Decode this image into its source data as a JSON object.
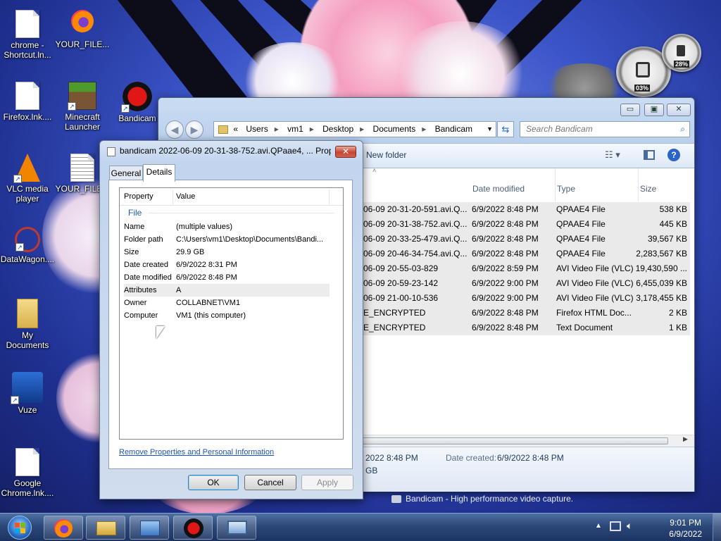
{
  "desktop": {
    "icons": [
      {
        "label": "chrome - Shortcut.ln..."
      },
      {
        "label": "YOUR_FILE..."
      },
      {
        "label": "Firefox.lnk...."
      },
      {
        "label": "Minecraft Launcher"
      },
      {
        "label": "Bandicam"
      },
      {
        "label": "VLC media player"
      },
      {
        "label": "YOUR_FILE..."
      },
      {
        "label": "DataWagon...."
      },
      {
        "label": "My Documents"
      },
      {
        "label": "Vuze"
      },
      {
        "label": "Google Chrome.lnk...."
      }
    ],
    "gadget": {
      "cpu_value": "03%",
      "mem_value": "28%"
    }
  },
  "explorer": {
    "caption_buttons": {
      "minimize": "▭",
      "maximize": "▣",
      "close": "✕"
    },
    "breadcrumb": [
      "«",
      "Users",
      "vm1",
      "Desktop",
      "Documents",
      "Bandicam"
    ],
    "search_placeholder": "Search Bandicam",
    "toolbar": {
      "new_folder": "New folder"
    },
    "columns": {
      "date": "Date modified",
      "type": "Type",
      "size": "Size"
    },
    "rows": [
      {
        "name": "06-09 20-31-20-591.avi.Q...",
        "date": "6/9/2022 8:48 PM",
        "type": "QPAAE4 File",
        "size": "538 KB"
      },
      {
        "name": "06-09 20-31-38-752.avi.Q...",
        "date": "6/9/2022 8:48 PM",
        "type": "QPAAE4 File",
        "size": "445 KB"
      },
      {
        "name": "06-09 20-33-25-479.avi.Q...",
        "date": "6/9/2022 8:48 PM",
        "type": "QPAAE4 File",
        "size": "39,567 KB"
      },
      {
        "name": "06-09 20-46-34-754.avi.Q...",
        "date": "6/9/2022 8:48 PM",
        "type": "QPAAE4 File",
        "size": "2,283,567 KB"
      },
      {
        "name": "06-09 20-55-03-829",
        "date": "6/9/2022 8:59 PM",
        "type": "AVI Video File (VLC)",
        "size": "19,430,590 ..."
      },
      {
        "name": "06-09 20-59-23-142",
        "date": "6/9/2022 9:00 PM",
        "type": "AVI Video File (VLC)",
        "size": "6,455,039 KB"
      },
      {
        "name": "06-09 21-00-10-536",
        "date": "6/9/2022 9:00 PM",
        "type": "AVI Video File (VLC)",
        "size": "3,178,455 KB"
      },
      {
        "name": "E_ENCRYPTED",
        "date": "6/9/2022 8:48 PM",
        "type": "Firefox HTML Doc...",
        "size": "2 KB"
      },
      {
        "name": "E_ENCRYPTED",
        "date": "6/9/2022 8:48 PM",
        "type": "Text Document",
        "size": "1 KB"
      }
    ],
    "details_pane": {
      "modified_partial": "2022 8:48 PM",
      "size_partial": "GB",
      "date_created_label": "Date created:",
      "date_created_value": "6/9/2022 8:48 PM"
    }
  },
  "properties": {
    "title": "bandicam 2022-06-09 20-31-38-752.avi.QPaae4, ... Prop...",
    "close_label": "✕",
    "tabs": {
      "general": "General",
      "details": "Details"
    },
    "list_header": {
      "property": "Property",
      "value": "Value"
    },
    "section": "File",
    "items": [
      {
        "key": "Name",
        "value": "(multiple values)"
      },
      {
        "key": "Folder path",
        "value": "C:\\Users\\vm1\\Desktop\\Documents\\Bandi..."
      },
      {
        "key": "Size",
        "value": "29.9 GB"
      },
      {
        "key": "Date created",
        "value": "6/9/2022 8:31 PM"
      },
      {
        "key": "Date modified",
        "value": "6/9/2022 8:48 PM"
      },
      {
        "key": "Attributes",
        "value": "A"
      },
      {
        "key": "Owner",
        "value": "COLLABNET\\VM1"
      },
      {
        "key": "Computer",
        "value": "VM1 (this computer)"
      }
    ],
    "remove_link": "Remove Properties and Personal Information",
    "buttons": {
      "ok": "OK",
      "cancel": "Cancel",
      "apply": "Apply"
    }
  },
  "watermark": "Bandicam - High performance video capture.",
  "taskbar": {
    "time": "9:01 PM",
    "date": "6/9/2022"
  }
}
